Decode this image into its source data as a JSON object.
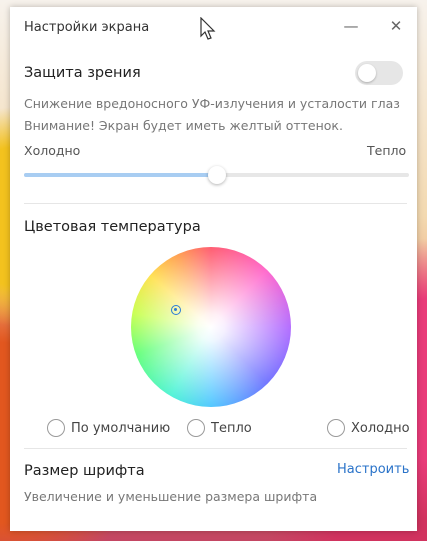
{
  "window": {
    "title": "Настройки экрана"
  },
  "eye_protection": {
    "title": "Защита зрения",
    "description_line1": "Снижение вредоносного УФ-излучения и усталости глаз",
    "description_line2": "Внимание! Экран будет иметь желтый оттенок.",
    "enabled": false,
    "slider": {
      "left_label": "Холодно",
      "right_label": "Тепло",
      "value_percent": 50
    }
  },
  "color_temperature": {
    "title": "Цветовая температура",
    "options": [
      {
        "label": "По умолчанию",
        "selected": false
      },
      {
        "label": "Тепло",
        "selected": false
      },
      {
        "label": "Холодно",
        "selected": false
      }
    ]
  },
  "font_size": {
    "title": "Размер шрифта",
    "action_label": "Настроить",
    "description": "Увеличение и уменьшение размера шрифта"
  },
  "colors": {
    "accent": "#2a73c9",
    "slider_fill": "#a8cdf2"
  }
}
